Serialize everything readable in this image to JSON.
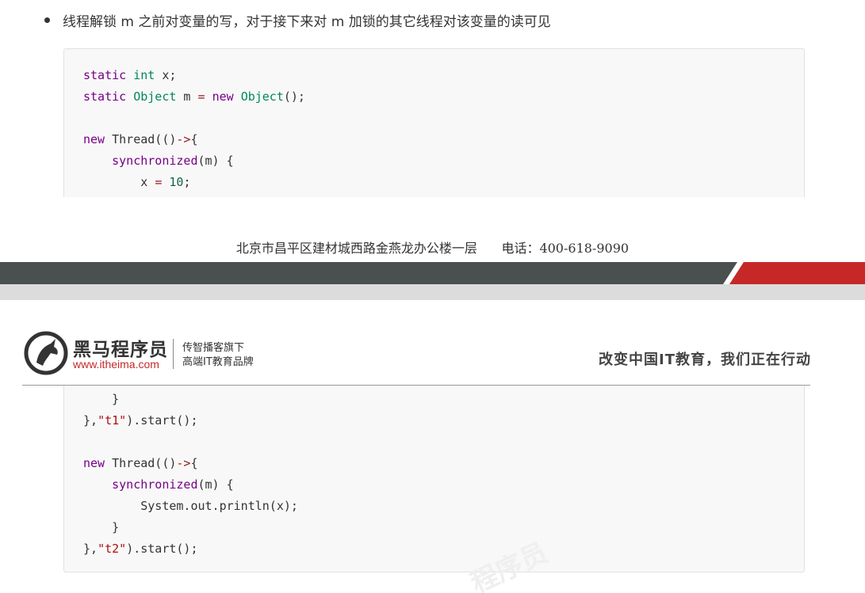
{
  "bullet": {
    "text": "线程解锁 m 之前对变量的写，对于接下来对 m 加锁的其它线程对该变量的读可见"
  },
  "code_top": [
    [
      {
        "t": "static",
        "c": "kw"
      },
      {
        "t": " ",
        "c": "pl"
      },
      {
        "t": "int",
        "c": "ty"
      },
      {
        "t": " x;",
        "c": "pl"
      }
    ],
    [
      {
        "t": "static",
        "c": "kw"
      },
      {
        "t": " ",
        "c": "pl"
      },
      {
        "t": "Object",
        "c": "ty"
      },
      {
        "t": " m ",
        "c": "pl"
      },
      {
        "t": "=",
        "c": "op"
      },
      {
        "t": " ",
        "c": "pl"
      },
      {
        "t": "new",
        "c": "kw"
      },
      {
        "t": " ",
        "c": "pl"
      },
      {
        "t": "Object",
        "c": "ty"
      },
      {
        "t": "();",
        "c": "pl"
      }
    ],
    [],
    [
      {
        "t": "new",
        "c": "kw"
      },
      {
        "t": " Thread(()",
        "c": "pl"
      },
      {
        "t": "->",
        "c": "op"
      },
      {
        "t": "{",
        "c": "pl"
      }
    ],
    [
      {
        "t": "    ",
        "c": "pl"
      },
      {
        "t": "synchronized",
        "c": "kw"
      },
      {
        "t": "(m) {",
        "c": "pl"
      }
    ],
    [
      {
        "t": "        x ",
        "c": "pl"
      },
      {
        "t": "=",
        "c": "op"
      },
      {
        "t": " ",
        "c": "pl"
      },
      {
        "t": "10",
        "c": "num"
      },
      {
        "t": ";",
        "c": "pl"
      }
    ]
  ],
  "footer": {
    "address": "北京市昌平区建材城西路金燕龙办公楼一层      电话：400-618-9090"
  },
  "brand": {
    "name_cn": "黑马程序员",
    "url": "www.itheima.com",
    "tagline1": "传智播客旗下",
    "tagline2": "高端IT教育品牌",
    "slogan": "改变中国IT教育，我们正在行动",
    "colors": {
      "red": "#c62828",
      "band_dark": "#4a4f50",
      "band_light": "#dcdcdc"
    }
  },
  "code_bottom": [
    [
      {
        "t": "    }",
        "c": "pl"
      }
    ],
    [
      {
        "t": "},",
        "c": "pl"
      },
      {
        "t": "\"t1\"",
        "c": "str"
      },
      {
        "t": ").start();",
        "c": "pl"
      }
    ],
    [],
    [
      {
        "t": "new",
        "c": "kw"
      },
      {
        "t": " Thread(()",
        "c": "pl"
      },
      {
        "t": "->",
        "c": "op"
      },
      {
        "t": "{",
        "c": "pl"
      }
    ],
    [
      {
        "t": "    ",
        "c": "pl"
      },
      {
        "t": "synchronized",
        "c": "kw"
      },
      {
        "t": "(m) {",
        "c": "pl"
      }
    ],
    [
      {
        "t": "        System.out.println(x);",
        "c": "pl"
      }
    ],
    [
      {
        "t": "    }",
        "c": "pl"
      }
    ],
    [
      {
        "t": "},",
        "c": "pl"
      },
      {
        "t": "\"t2\"",
        "c": "str"
      },
      {
        "t": ").start();",
        "c": "pl"
      }
    ]
  ],
  "watermark": {
    "text": "程序员"
  }
}
